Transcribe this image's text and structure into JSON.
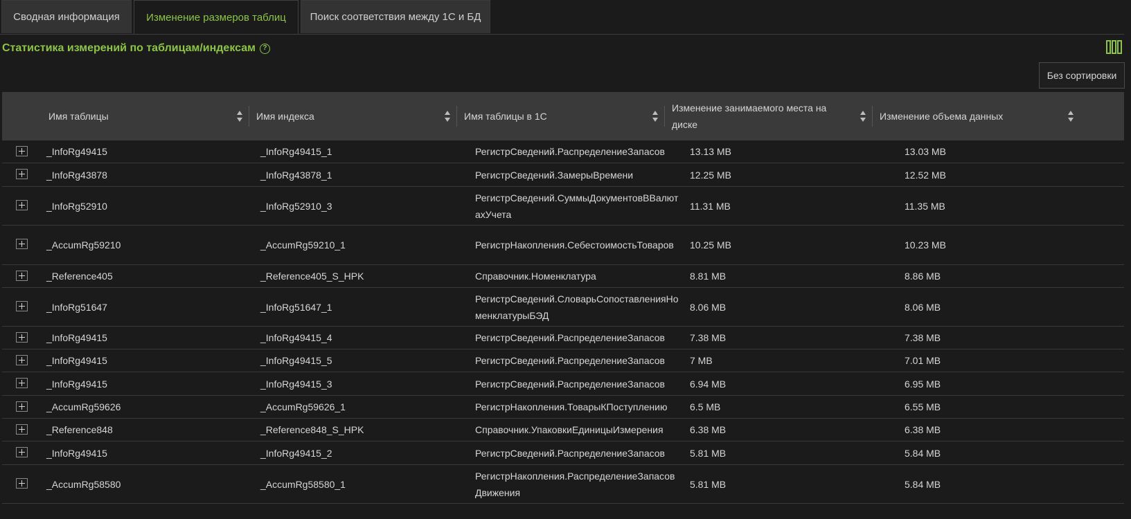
{
  "tabs": [
    {
      "label": "Сводная информация",
      "active": false
    },
    {
      "label": "Изменение размеров таблиц",
      "active": true
    },
    {
      "label": "Поиск соответствия между 1С и БД",
      "active": false
    }
  ],
  "section": {
    "title": "Статистика измерений по таблицам/индексам",
    "help_icon": "help-circle-icon",
    "columns_icon": "columns-icon"
  },
  "sort_button": "Без сортировки",
  "colors": {
    "accent": "#8cc63f",
    "background": "#1b1b1b",
    "header_bg": "#3a3a3a"
  },
  "table": {
    "columns": [
      "Имя таблицы",
      "Имя индекса",
      "Имя таблицы в 1С",
      "Изменение занимаемого места на диске",
      "Изменение объема данных"
    ],
    "rows": [
      {
        "name": "_InfoRg49415",
        "index": "_InfoRg49415_1",
        "table_1c": "РегистрСведений.РаспределениеЗапасов",
        "disk": "13.13 MB",
        "data": "13.03 MB"
      },
      {
        "name": "_InfoRg43878",
        "index": "_InfoRg43878_1",
        "table_1c": "РегистрСведений.ЗамерыВремени",
        "disk": "12.25 MB",
        "data": "12.52 MB"
      },
      {
        "name": "_InfoRg52910",
        "index": "_InfoRg52910_3",
        "table_1c": "РегистрСведений.СуммыДокументовВВалютахУчета",
        "disk": "11.31 MB",
        "data": "11.35 MB"
      },
      {
        "name": "_AccumRg59210",
        "index": "_AccumRg59210_1",
        "table_1c": "РегистрНакопления.СебестоимостьТоваров",
        "disk": "10.25 MB",
        "data": "10.23 MB"
      },
      {
        "name": "_Reference405",
        "index": "_Reference405_S_HPK",
        "table_1c": "Справочник.Номенклатура",
        "disk": "8.81 MB",
        "data": "8.86 MB"
      },
      {
        "name": "_InfoRg51647",
        "index": "_InfoRg51647_1",
        "table_1c": "РегистрСведений.СловарьСопоставленияНоменклатурыБЭД",
        "disk": "8.06 MB",
        "data": "8.06 MB"
      },
      {
        "name": "_InfoRg49415",
        "index": "_InfoRg49415_4",
        "table_1c": "РегистрСведений.РаспределениеЗапасов",
        "disk": "7.38 MB",
        "data": "7.38 MB"
      },
      {
        "name": "_InfoRg49415",
        "index": "_InfoRg49415_5",
        "table_1c": "РегистрСведений.РаспределениеЗапасов",
        "disk": "7 MB",
        "data": "7.01 MB"
      },
      {
        "name": "_InfoRg49415",
        "index": "_InfoRg49415_3",
        "table_1c": "РегистрСведений.РаспределениеЗапасов",
        "disk": "6.94 MB",
        "data": "6.95 MB"
      },
      {
        "name": "_AccumRg59626",
        "index": "_AccumRg59626_1",
        "table_1c": "РегистрНакопления.ТоварыКПоступлению",
        "disk": "6.5 MB",
        "data": "6.55 MB"
      },
      {
        "name": "_Reference848",
        "index": "_Reference848_S_HPK",
        "table_1c": "Справочник.УпаковкиЕдиницыИзмерения",
        "disk": "6.38 MB",
        "data": "6.38 MB"
      },
      {
        "name": "_InfoRg49415",
        "index": "_InfoRg49415_2",
        "table_1c": "РегистрСведений.РаспределениеЗапасов",
        "disk": "5.81 MB",
        "data": "5.84 MB"
      },
      {
        "name": "_AccumRg58580",
        "index": "_AccumRg58580_1",
        "table_1c": "РегистрНакопления.РаспределениеЗапасовДвижения",
        "disk": "5.81 MB",
        "data": "5.84 MB"
      }
    ]
  }
}
